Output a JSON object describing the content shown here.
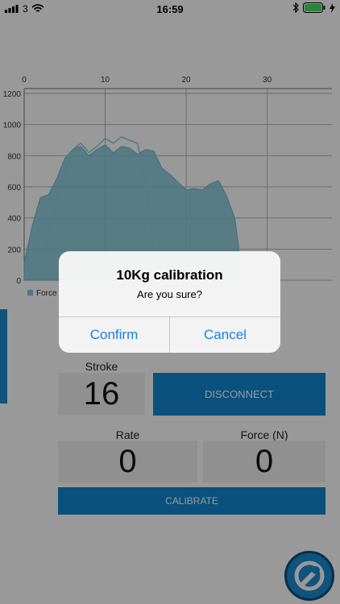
{
  "status_bar": {
    "carrier": "3",
    "time": "16:59"
  },
  "chart_data": {
    "type": "area",
    "x_ticks": [
      "0",
      "10",
      "20",
      "30"
    ],
    "y_ticks": [
      "0",
      "200",
      "400",
      "600",
      "800",
      "1000",
      "1200"
    ],
    "xlim": [
      0,
      38
    ],
    "ylim": [
      0,
      1200
    ],
    "grid": true,
    "legend": "bottom-left",
    "series": [
      {
        "name": "Force",
        "color": "#7fc7d9",
        "x": [
          0,
          1,
          2,
          3,
          4,
          5,
          6,
          7,
          8,
          9,
          10,
          11,
          12,
          13,
          14,
          15,
          16,
          17,
          18,
          19,
          20,
          21,
          22,
          23,
          24,
          25,
          26,
          27
        ],
        "values": [
          110,
          350,
          530,
          550,
          650,
          780,
          840,
          860,
          800,
          840,
          870,
          820,
          860,
          850,
          810,
          840,
          830,
          720,
          680,
          630,
          580,
          590,
          580,
          620,
          640,
          540,
          400,
          10
        ]
      },
      {
        "x": [
          0,
          2,
          4,
          6,
          7,
          8,
          9,
          10,
          11,
          12,
          13,
          14,
          15,
          16,
          17,
          18
        ],
        "values": [
          0,
          80,
          510,
          840,
          880,
          820,
          860,
          910,
          880,
          920,
          900,
          880,
          630,
          200,
          20,
          0
        ]
      }
    ]
  },
  "labels": {
    "stroke": "Stroke",
    "rate": "Rate",
    "force": "Force (N)"
  },
  "values": {
    "stroke": "16",
    "rate": "0",
    "force": "0"
  },
  "buttons": {
    "disconnect": "DISCONNECT",
    "calibrate": "CALIBRATE"
  },
  "dialog": {
    "title": "10Kg calibration",
    "message": "Are you sure?",
    "confirm": "Confirm",
    "cancel": "Cancel"
  },
  "colors": {
    "accent": "#1187d0",
    "link": "#1a7fe0"
  },
  "icons": {
    "tool_button": "wrench-icon"
  }
}
